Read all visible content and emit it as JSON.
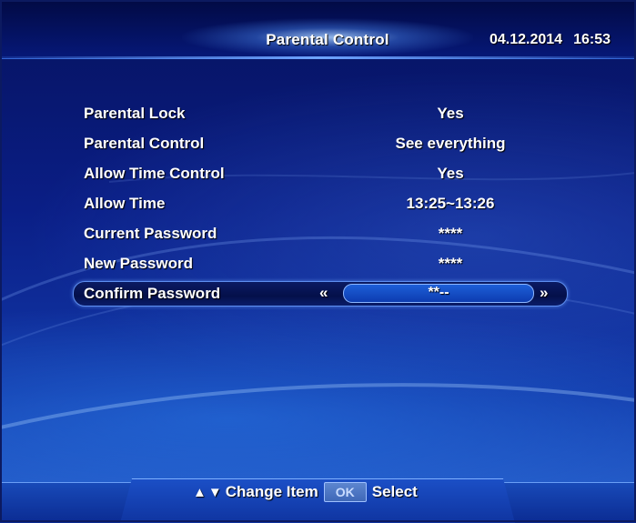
{
  "header": {
    "title": "Parental Control",
    "date": "04.12.2014",
    "time": "16:53"
  },
  "menu": {
    "items": [
      {
        "label": "Parental Lock",
        "value": "Yes"
      },
      {
        "label": "Parental Control",
        "value": "See everything"
      },
      {
        "label": "Allow Time Control",
        "value": "Yes"
      },
      {
        "label": "Allow Time",
        "value": "13:25~13:26"
      },
      {
        "label": "Current Password",
        "value": "****"
      },
      {
        "label": "New Password",
        "value": "****"
      },
      {
        "label": "Confirm Password",
        "value": "**--"
      }
    ],
    "selected_index": 6,
    "arrow_left": "«",
    "arrow_right": "»"
  },
  "footer": {
    "up_arrow": "▲",
    "down_arrow": "▼",
    "change_item_label": "Change Item",
    "ok_key": "OK",
    "select_label": "Select"
  },
  "colors": {
    "background_top": "#06125e",
    "background_bottom": "#2a66d2",
    "highlight_field": "#1d5fd8",
    "text": "#ffffff"
  }
}
